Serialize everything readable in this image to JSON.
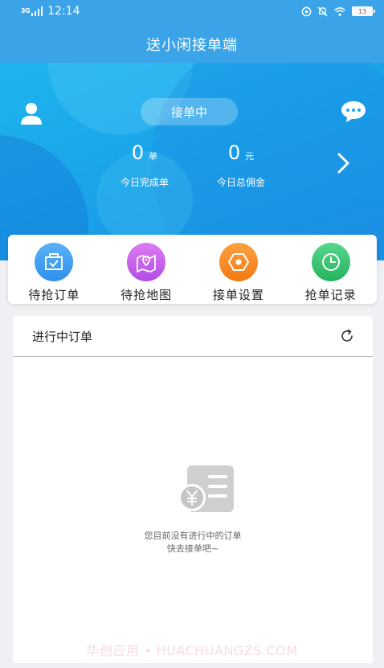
{
  "status_bar": {
    "network": "3G",
    "time": "12:14",
    "battery": "13"
  },
  "app": {
    "title": "送小闲接单端"
  },
  "hero": {
    "status_label": "接单中",
    "completed": {
      "value": "0",
      "unit": "单",
      "label": "今日完成单"
    },
    "commission": {
      "value": "0",
      "unit": "元",
      "label": "今日总佣金"
    }
  },
  "actions": [
    {
      "label": "待抢订单",
      "icon": "order-box-icon",
      "color": "#3b9cf1"
    },
    {
      "label": "待抢地图",
      "icon": "map-pin-icon",
      "color": "#c15be8"
    },
    {
      "label": "接单设置",
      "icon": "settings-hex-icon",
      "color": "#f58a1f"
    },
    {
      "label": "抢单记录",
      "icon": "clock-icon",
      "color": "#2fbf6a"
    }
  ],
  "orders": {
    "title": "进行中订单",
    "empty_line1": "您目前没有进行中的订单",
    "empty_line2": "快去接单吧~"
  },
  "watermark": "华创应用 • HUACHUANGZS.COM",
  "colors": {
    "accent": "#1aa4ea",
    "header": "#3ba3e8"
  }
}
